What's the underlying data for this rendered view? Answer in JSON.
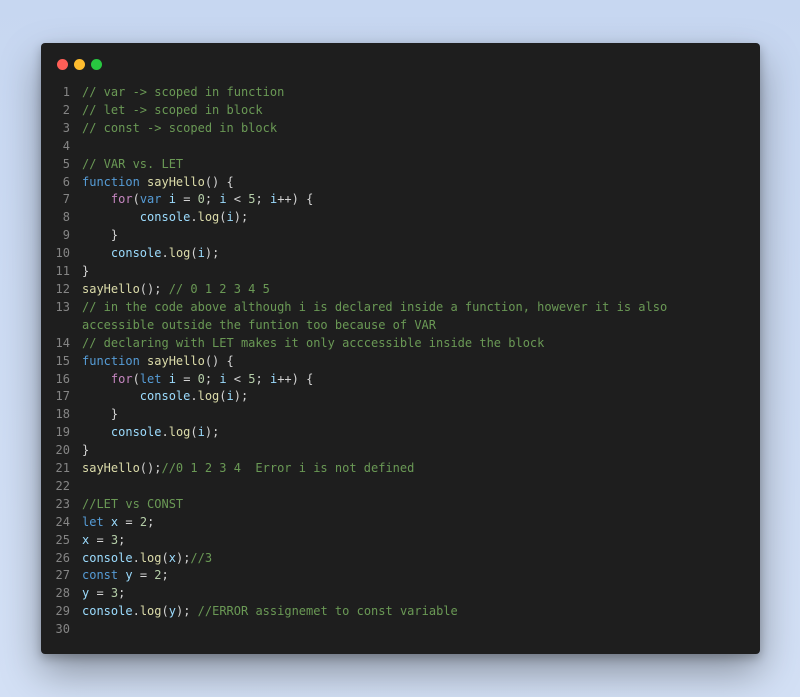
{
  "window": {
    "controls": [
      "close",
      "minimize",
      "maximize"
    ],
    "colors": {
      "close": "#ff5f57",
      "minimize": "#febc2e",
      "maximize": "#28c840",
      "background": "#1e1e1e"
    }
  },
  "code": {
    "lines": [
      {
        "n": "1",
        "t": [
          [
            "comment",
            "// var -> scoped in function"
          ]
        ]
      },
      {
        "n": "2",
        "t": [
          [
            "comment",
            "// let -> scoped in block"
          ]
        ]
      },
      {
        "n": "3",
        "t": [
          [
            "comment",
            "// const -> scoped in block"
          ]
        ]
      },
      {
        "n": "4",
        "t": []
      },
      {
        "n": "5",
        "t": [
          [
            "comment",
            "// VAR vs. LET"
          ]
        ]
      },
      {
        "n": "6",
        "t": [
          [
            "keyword",
            "function "
          ],
          [
            "func",
            "sayHello"
          ],
          [
            "plain",
            "() {"
          ]
        ]
      },
      {
        "n": "7",
        "t": [
          [
            "plain",
            "    "
          ],
          [
            "control",
            "for"
          ],
          [
            "plain",
            "("
          ],
          [
            "keyword",
            "var "
          ],
          [
            "var",
            "i"
          ],
          [
            "plain",
            " = "
          ],
          [
            "num",
            "0"
          ],
          [
            "plain",
            "; "
          ],
          [
            "var",
            "i"
          ],
          [
            "plain",
            " < "
          ],
          [
            "num",
            "5"
          ],
          [
            "plain",
            "; "
          ],
          [
            "var",
            "i"
          ],
          [
            "plain",
            "++) {"
          ]
        ]
      },
      {
        "n": "8",
        "t": [
          [
            "plain",
            "        "
          ],
          [
            "var",
            "console"
          ],
          [
            "plain",
            "."
          ],
          [
            "func",
            "log"
          ],
          [
            "plain",
            "("
          ],
          [
            "var",
            "i"
          ],
          [
            "plain",
            ");"
          ]
        ]
      },
      {
        "n": "9",
        "t": [
          [
            "plain",
            "    }"
          ]
        ]
      },
      {
        "n": "10",
        "t": [
          [
            "plain",
            "    "
          ],
          [
            "var",
            "console"
          ],
          [
            "plain",
            "."
          ],
          [
            "func",
            "log"
          ],
          [
            "plain",
            "("
          ],
          [
            "var",
            "i"
          ],
          [
            "plain",
            ");"
          ]
        ]
      },
      {
        "n": "11",
        "t": [
          [
            "plain",
            "}"
          ]
        ]
      },
      {
        "n": "12",
        "t": [
          [
            "func",
            "sayHello"
          ],
          [
            "plain",
            "(); "
          ],
          [
            "comment",
            "// 0 1 2 3 4 5"
          ]
        ]
      },
      {
        "n": "13",
        "t": [
          [
            "comment",
            "// in the code above although i is declared inside a function, however it is also accessible outside the funtion too because of VAR"
          ]
        ]
      },
      {
        "n": "14",
        "t": [
          [
            "comment",
            "// declaring with LET makes it only acccessible inside the block"
          ]
        ]
      },
      {
        "n": "15",
        "t": [
          [
            "keyword",
            "function "
          ],
          [
            "func",
            "sayHello"
          ],
          [
            "plain",
            "() {"
          ]
        ]
      },
      {
        "n": "16",
        "t": [
          [
            "plain",
            "    "
          ],
          [
            "control",
            "for"
          ],
          [
            "plain",
            "("
          ],
          [
            "keyword",
            "let "
          ],
          [
            "var",
            "i"
          ],
          [
            "plain",
            " = "
          ],
          [
            "num",
            "0"
          ],
          [
            "plain",
            "; "
          ],
          [
            "var",
            "i"
          ],
          [
            "plain",
            " < "
          ],
          [
            "num",
            "5"
          ],
          [
            "plain",
            "; "
          ],
          [
            "var",
            "i"
          ],
          [
            "plain",
            "++) {"
          ]
        ]
      },
      {
        "n": "17",
        "t": [
          [
            "plain",
            "        "
          ],
          [
            "var",
            "console"
          ],
          [
            "plain",
            "."
          ],
          [
            "func",
            "log"
          ],
          [
            "plain",
            "("
          ],
          [
            "var",
            "i"
          ],
          [
            "plain",
            ");"
          ]
        ]
      },
      {
        "n": "18",
        "t": [
          [
            "plain",
            "    }"
          ]
        ]
      },
      {
        "n": "19",
        "t": [
          [
            "plain",
            "    "
          ],
          [
            "var",
            "console"
          ],
          [
            "plain",
            "."
          ],
          [
            "func",
            "log"
          ],
          [
            "plain",
            "("
          ],
          [
            "var",
            "i"
          ],
          [
            "plain",
            ");"
          ]
        ]
      },
      {
        "n": "20",
        "t": [
          [
            "plain",
            "}"
          ]
        ]
      },
      {
        "n": "21",
        "t": [
          [
            "func",
            "sayHello"
          ],
          [
            "plain",
            "();"
          ],
          [
            "comment",
            "//0 1 2 3 4  Error i is not defined"
          ]
        ]
      },
      {
        "n": "22",
        "t": []
      },
      {
        "n": "23",
        "t": [
          [
            "comment",
            "//LET vs CONST"
          ]
        ]
      },
      {
        "n": "24",
        "t": [
          [
            "keyword",
            "let "
          ],
          [
            "var",
            "x"
          ],
          [
            "plain",
            " = "
          ],
          [
            "num",
            "2"
          ],
          [
            "plain",
            ";"
          ]
        ]
      },
      {
        "n": "25",
        "t": [
          [
            "var",
            "x"
          ],
          [
            "plain",
            " = "
          ],
          [
            "num",
            "3"
          ],
          [
            "plain",
            ";"
          ]
        ]
      },
      {
        "n": "26",
        "t": [
          [
            "var",
            "console"
          ],
          [
            "plain",
            "."
          ],
          [
            "func",
            "log"
          ],
          [
            "plain",
            "("
          ],
          [
            "var",
            "x"
          ],
          [
            "plain",
            ");"
          ],
          [
            "comment",
            "//3"
          ]
        ]
      },
      {
        "n": "27",
        "t": [
          [
            "keyword",
            "const "
          ],
          [
            "var",
            "y"
          ],
          [
            "plain",
            " = "
          ],
          [
            "num",
            "2"
          ],
          [
            "plain",
            ";"
          ]
        ]
      },
      {
        "n": "28",
        "t": [
          [
            "var",
            "y"
          ],
          [
            "plain",
            " = "
          ],
          [
            "num",
            "3"
          ],
          [
            "plain",
            ";"
          ]
        ]
      },
      {
        "n": "29",
        "t": [
          [
            "var",
            "console"
          ],
          [
            "plain",
            "."
          ],
          [
            "func",
            "log"
          ],
          [
            "plain",
            "("
          ],
          [
            "var",
            "y"
          ],
          [
            "plain",
            "); "
          ],
          [
            "comment",
            "//ERROR assignemet to const variable"
          ]
        ]
      },
      {
        "n": "30",
        "t": []
      }
    ]
  }
}
